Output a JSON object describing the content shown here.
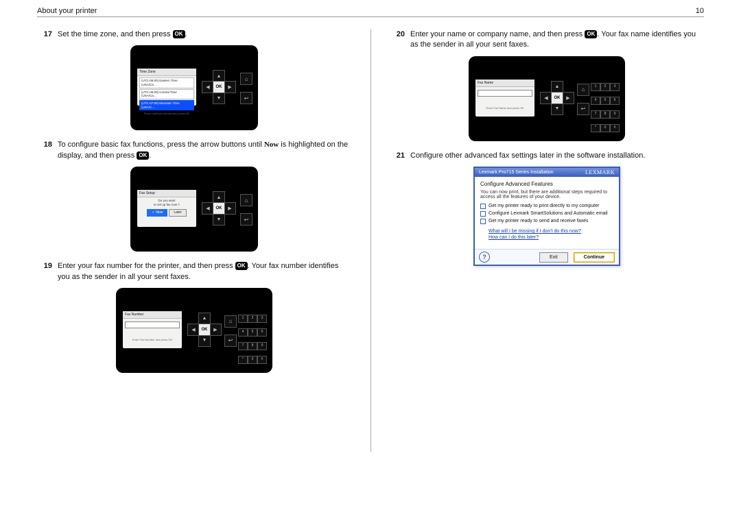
{
  "header": {
    "title": "About your printer",
    "page_number": "10"
  },
  "ok_label": "OK",
  "steps": {
    "s17": {
      "num": "17",
      "pre": "Set the time zone, and then press ",
      "post": "."
    },
    "s18": {
      "num": "18",
      "pre": "To configure basic fax functions, press the arrow buttons until ",
      "now_word": "Now",
      "mid": " is highlighted on the display, and then press ",
      "post": "."
    },
    "s19": {
      "num": "19",
      "pre": "Enter your fax number for the printer, and then press ",
      "post": ". Your fax number identifies you as the sender in all your sent faxes."
    },
    "s20": {
      "num": "20",
      "pre": "Enter your name or company name, and then press ",
      "post": ". Your fax name identifies you as the sender in all your sent faxes."
    },
    "s21": {
      "num": "21",
      "text": "Configure other advanced fax settings later in the software installation."
    }
  },
  "panel": {
    "dpad": {
      "up": "▲",
      "down": "▼",
      "left": "◀",
      "right": "▶",
      "ok": "OK"
    },
    "side": {
      "home": "⌂",
      "back": "↩"
    },
    "numpad": [
      "1",
      "2",
      "3",
      "4",
      "5",
      "6",
      "7",
      "8",
      "9",
      "*",
      "0",
      "#"
    ]
  },
  "lcd17": {
    "title": "Time Zone",
    "items": [
      "(UTC-05:00) Eastern Time (USA/Ca…",
      "(UTC-06:00) Central Time (USA/Ca…",
      "(UTC-07:00) Mountain Time (USA/C…"
    ],
    "hint": "Press Up/Down Arrows and press OK"
  },
  "lcd18": {
    "title": "Fax Setup",
    "prompt1": "Do you want",
    "prompt2": "to set up fax now ?",
    "now": "Now",
    "later": "Later",
    "check": "✓"
  },
  "lcd19": {
    "title": "Fax Number",
    "hint": "Enter Fax Number and press OK"
  },
  "lcd20": {
    "title": "Fax Name",
    "hint": "Enter Fax Name and press OK"
  },
  "sw": {
    "window_title": "Lexmark Pro715 Series Installation",
    "brand": "LEXMARK",
    "heading": "Configure Advanced Features",
    "description": "You can now print, but there are additional steps required to access all the features of your device.",
    "checks": [
      "Get my printer ready to print directly to my computer",
      "Configure Lexmark SmartSolutions and Automatic email",
      "Get my printer ready to send and receive faxes"
    ],
    "link1": "What will I be missing if I don't do this now?",
    "link2": "How can I do this later?",
    "help": "?",
    "btn_exit": "Exit",
    "btn_continue": "Continue"
  }
}
